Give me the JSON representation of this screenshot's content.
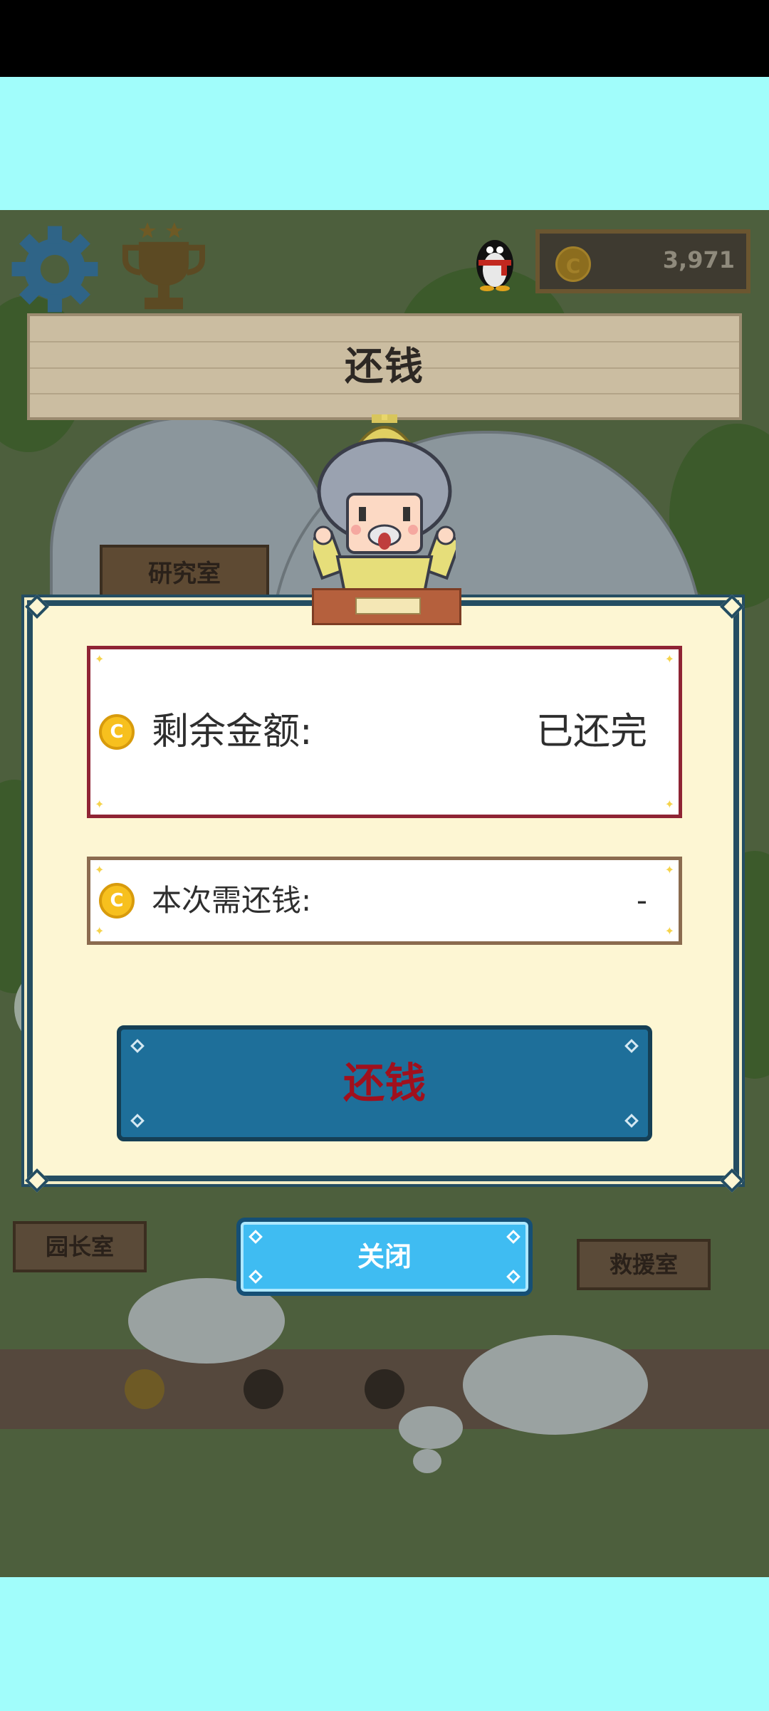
{
  "hud": {
    "coin_amount": "3,971",
    "coin_symbol": "C",
    "icons": [
      "gear-icon",
      "trophy-icon",
      "qq-penguin-icon",
      "coin-icon"
    ]
  },
  "banner": {
    "title": "还钱"
  },
  "background_signs": {
    "research": "研究室",
    "director": "园长室",
    "rescue": "救援室"
  },
  "dialog": {
    "remaining": {
      "label": "剩余金额:",
      "value": "已还完",
      "coin_symbol": "C"
    },
    "due": {
      "label": "本次需还钱:",
      "value": "-",
      "coin_symbol": "C"
    },
    "repay_button": "还钱"
  },
  "close_button": "关闭",
  "colors": {
    "frame_cyan": "#a1fdfb",
    "dialog_bg": "#fdf6d3",
    "dialog_border": "#244d62",
    "remaining_border": "#8f2434",
    "repay_button_bg": "#1e6f9a",
    "repay_text": "#a0101d",
    "close_button_bg": "#3fbcf2"
  }
}
